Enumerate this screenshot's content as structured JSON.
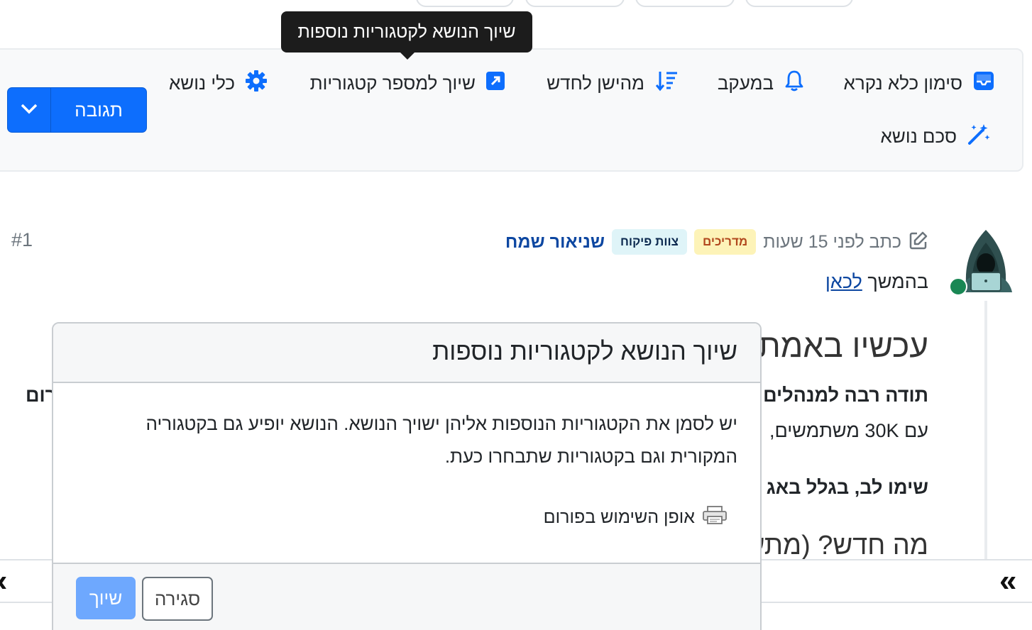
{
  "tooltip": {
    "text": "שיוך הנושא לקטגוריות נוספות"
  },
  "toolbar": {
    "mark_unread": "סימון כלא נקרא",
    "watching": "במעקב",
    "oldest_to_newest": "מהישן לחדש",
    "assign_categories": "שיוך למספר קטגוריות",
    "topic_tools": "כלי נושא",
    "summarize": "סכם נושא",
    "reply_label": "תגובה"
  },
  "post": {
    "index": "#1",
    "author": "שניאור שמח",
    "badges": [
      "צוות פיקוח",
      "מדריכים"
    ],
    "time": "כתב לפני 15 שעות",
    "line1_prefix": "בהמשך ",
    "line1_link": "לכאן",
    "heading_visible": "עכשיו באמת",
    "bold_line_visible": "תודה רבה למנהלים",
    "line3_visible": "עם 30K משתמשים,",
    "left_fragment": "רום",
    "bold_line2_visible": "שימו לב, בגלל באג",
    "heading2_visible": "מה חדש? (מתע"
  },
  "modal": {
    "title": "שיוך הנושא לקטגוריות נוספות",
    "body": "יש לסמן את הקטגוריות הנוספות אליהן ישויך הנושא. הנושא יופיע גם בקטגוריה המקורית וגם בקטגוריות שתבחרו כעת.",
    "usage_link": "אופן השימוש בפורום",
    "assign_button": "שיוך",
    "close_button": "סגירה"
  },
  "nav": {
    "left_arrow": "«",
    "right_arrow": "«"
  },
  "colors": {
    "primary": "#0d6efd",
    "link": "#0d47a1",
    "online": "#198754"
  }
}
